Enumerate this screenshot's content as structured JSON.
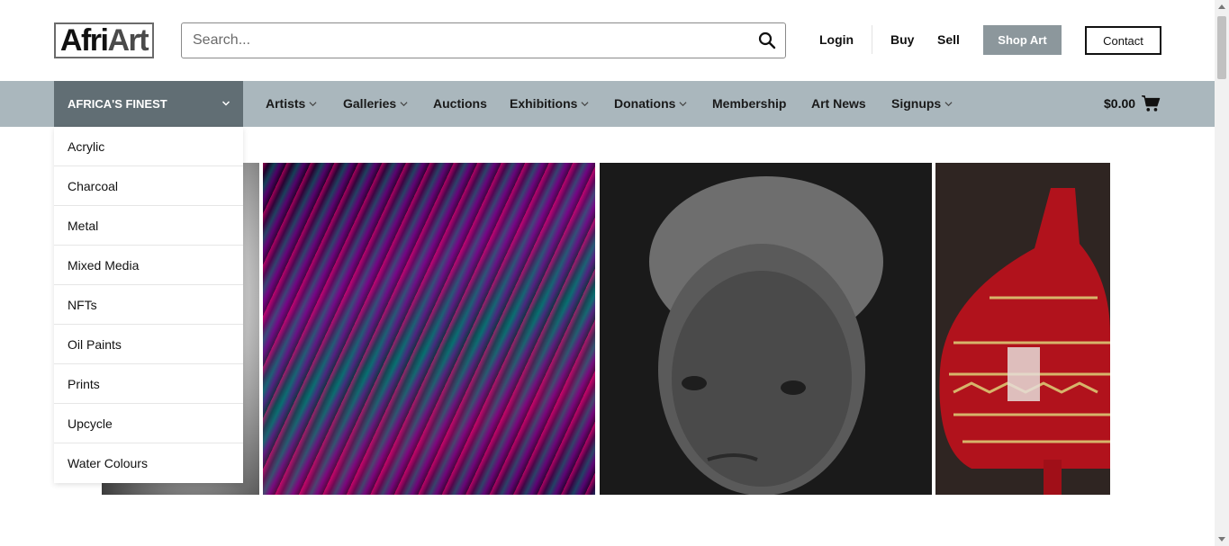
{
  "header": {
    "logo": {
      "part1": "Afri",
      "part2": "Art"
    },
    "search": {
      "placeholder": "Search...",
      "icon": "search-icon"
    },
    "login": "Login",
    "buy": "Buy",
    "sell": "Sell",
    "shop_art": "Shop Art",
    "contact": "Contact"
  },
  "nav": {
    "featured": "AFRICA'S FINEST",
    "items": [
      {
        "label": "Artists"
      },
      {
        "label": "Galleries"
      },
      {
        "label": "Auctions"
      },
      {
        "label": "Exhibitions"
      },
      {
        "label": "Donations"
      },
      {
        "label": "Membership"
      },
      {
        "label": "Art News"
      },
      {
        "label": "Signups"
      }
    ],
    "cart_total": "$0.00",
    "cart_icon": "cart-icon"
  },
  "dropdown": {
    "items": [
      "Acrylic",
      "Charcoal",
      "Metal",
      "Mixed Media",
      "NFTs",
      "Oil Paints",
      "Prints",
      "Upcycle",
      "Water Colours"
    ]
  },
  "gallery": {
    "tiles": [
      "bw-photo",
      "abstract-feathers",
      "boy-portrait-bw",
      "red-painted-gourd"
    ]
  },
  "colors": {
    "navbar": "#aab7bd",
    "featured_bg": "#616e74",
    "shop_art_bg": "#8c979c"
  }
}
